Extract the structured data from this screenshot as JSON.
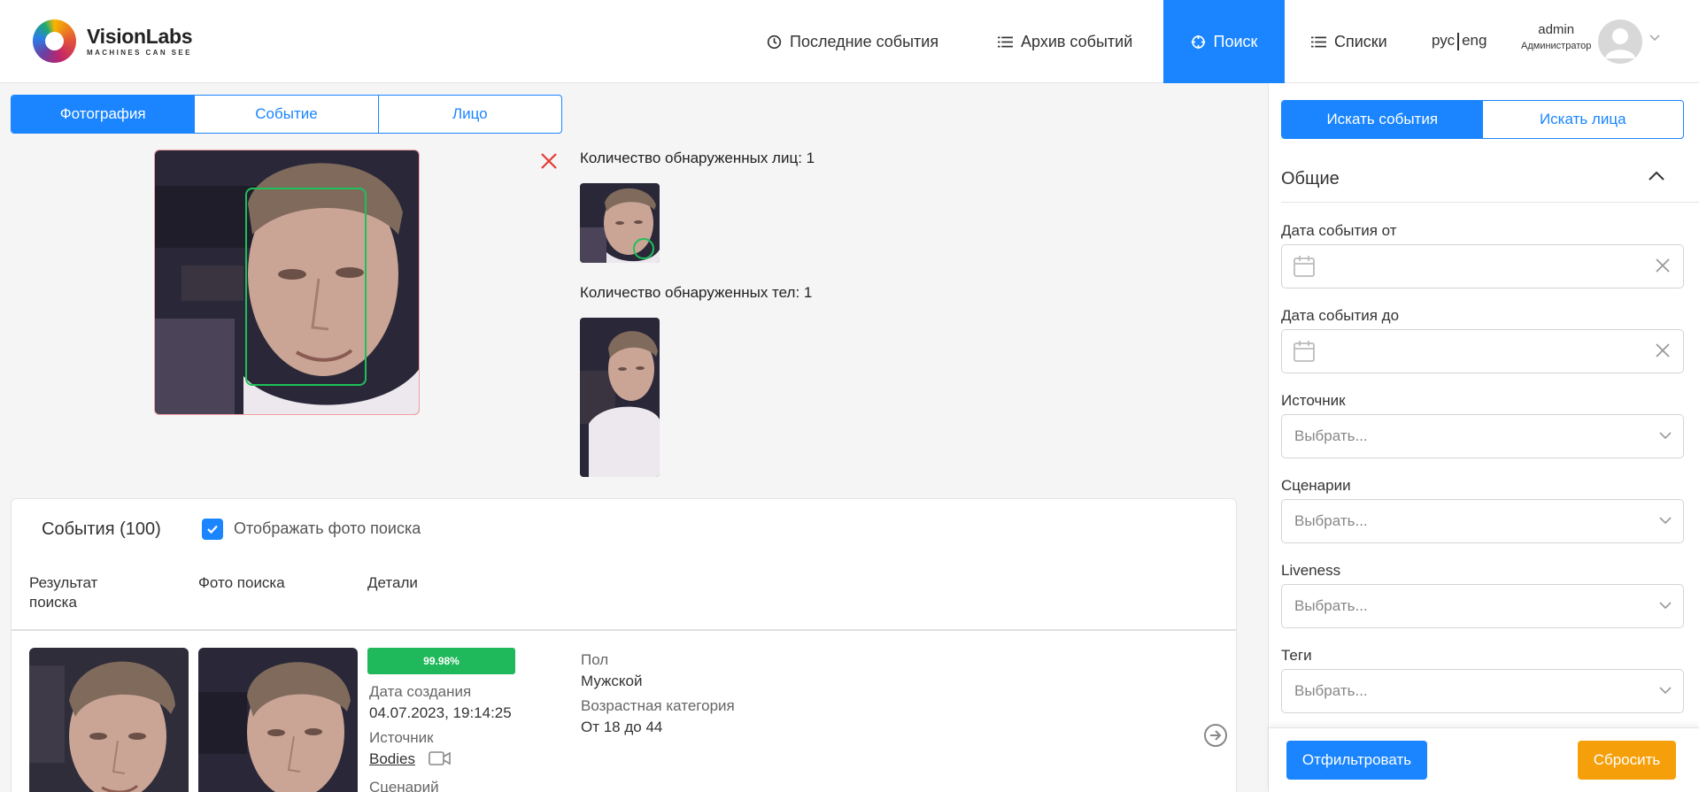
{
  "brand": {
    "name": "VisionLabs",
    "tagline": "MACHINES CAN SEE"
  },
  "nav": {
    "items": [
      {
        "label": "Последние события",
        "icon": "clock-icon"
      },
      {
        "label": "Архив событий",
        "icon": "list-icon"
      },
      {
        "label": "Поиск",
        "icon": "crosshair-icon",
        "active": true
      },
      {
        "label": "Списки",
        "icon": "list-icon"
      }
    ],
    "lang_ru": "рус",
    "lang_en": "eng"
  },
  "user": {
    "name": "admin",
    "role": "Администратор"
  },
  "search_tabs": [
    "Фотография",
    "Событие",
    "Лицо"
  ],
  "detection": {
    "faces_label": "Количество обнаруженных лиц: 1",
    "bodies_label": "Количество обнаруженных тел: 1"
  },
  "events": {
    "title": "События (100)",
    "show_photo_label": "Отображать фото поиска",
    "show_photo_checked": true,
    "columns": {
      "result": "Результат поиска",
      "search_photo": "Фото поиска",
      "details": "Детали"
    },
    "rows": [
      {
        "score": "99.98%",
        "created_label": "Дата создания",
        "created_value": "04.07.2023, 19:14:25",
        "source_label": "Источник",
        "source_value": "Bodies",
        "scenario_label": "Сценарий",
        "gender_label": "Пол",
        "gender_value": "Мужской",
        "age_label": "Возрастная категория",
        "age_value": "От 18 до 44"
      }
    ]
  },
  "sidebar": {
    "tabs": [
      "Искать события",
      "Искать лица"
    ],
    "section_title": "Общие",
    "fields": {
      "date_from": "Дата события от",
      "date_to": "Дата события до",
      "source": "Источник",
      "scenarios": "Сценарии",
      "liveness": "Liveness",
      "tags": "Теги",
      "placeholder": "Выбрать..."
    },
    "filter_button": "Отфильтровать",
    "reset_button": "Сбросить"
  },
  "colors": {
    "accent": "#1a85ff",
    "success": "#1fb85a",
    "warning": "#f5a00a",
    "danger": "#e53935"
  }
}
